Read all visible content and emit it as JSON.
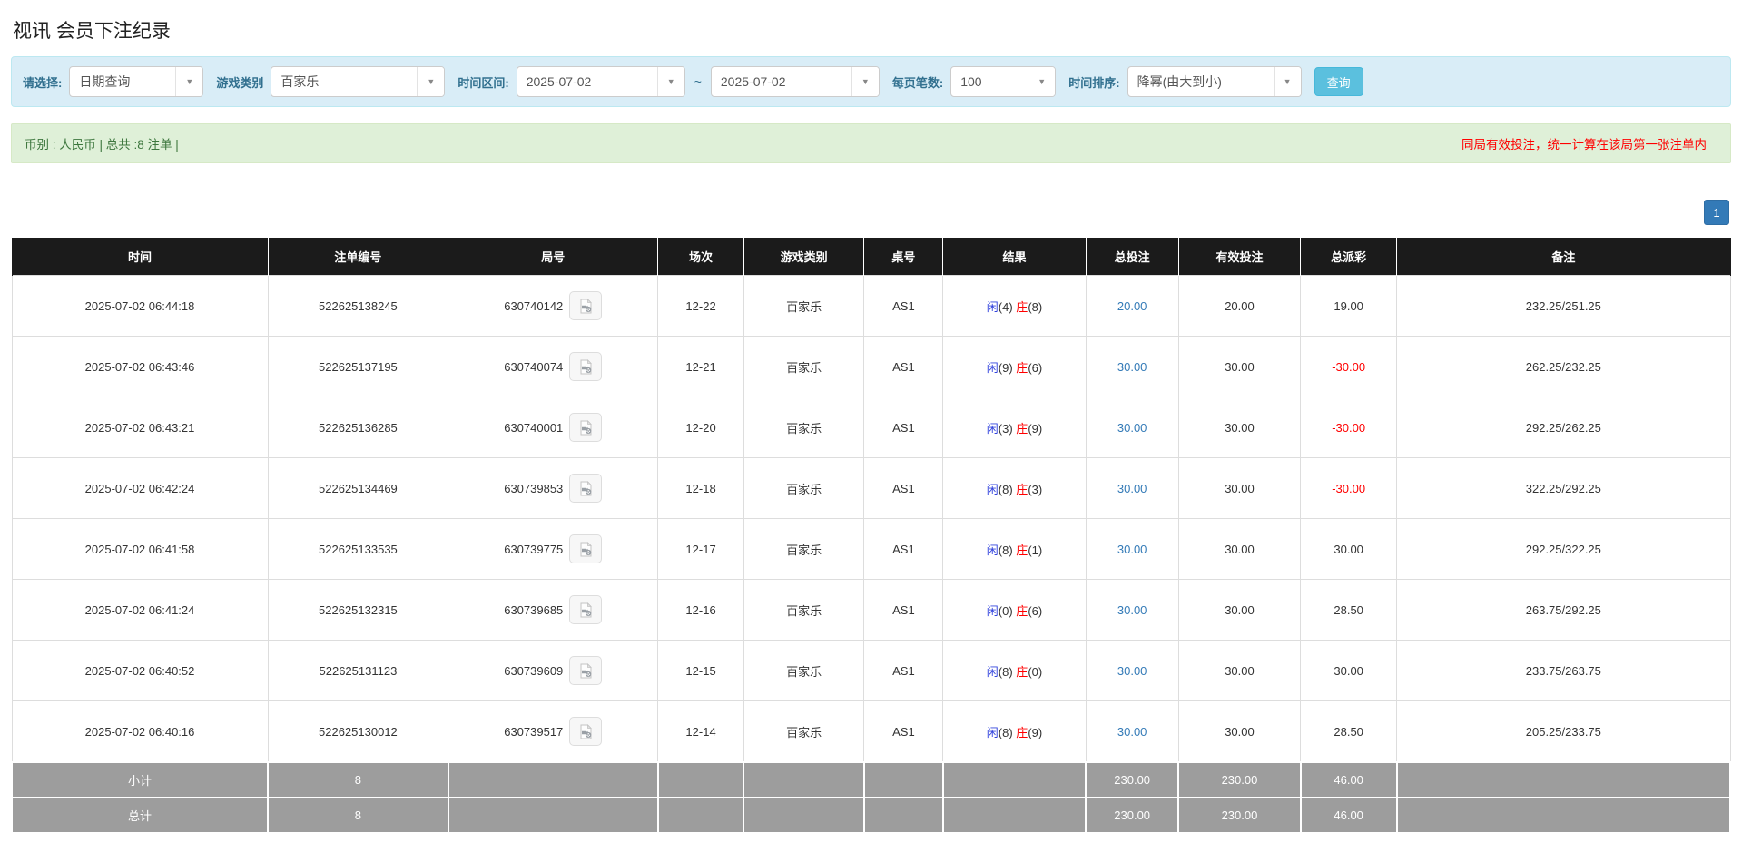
{
  "page": {
    "title": "视讯 会员下注纪录"
  },
  "filters": {
    "query_type_label": "请选择:",
    "query_type_value": "日期查询",
    "game_label": "游戏类别",
    "game_value": "百家乐",
    "range_label": "时间区间:",
    "date_from": "2025-07-02",
    "range_separator": "~",
    "date_to": "2025-07-02",
    "per_page_label": "每页笔数:",
    "per_page_value": "100",
    "sort_label": "时间排序:",
    "sort_value": "降幂(由大到小)",
    "search_button_label": "查询"
  },
  "summary_bar": {
    "left_text": "币别 : 人民币 | 总共 :8 注单 |",
    "right_text": "同局有效投注，统一计算在该局第一张注单内"
  },
  "pagination": {
    "current_page": "1"
  },
  "icons": {
    "dropdown_arrow": "▼",
    "video_replay": "video-replay-icon"
  },
  "colors": {
    "panel_bg": "#d9edf7",
    "panel_border": "#bce8f1",
    "label_text": "#31708f",
    "search_button_bg": "#5bc0de",
    "alert_bg": "#dff0d8",
    "alert_text": "#3c763d",
    "alert_warning_text": "#ff0000",
    "header_bg": "#1b1b1b",
    "link_blue": "#337ab7",
    "player_blue": "#3344dd",
    "banker_red": "#ff0000",
    "negative_red": "#ff0000",
    "summary_row_bg": "#9d9d9d",
    "pagination_bg": "#337ab7"
  },
  "table": {
    "headers": [
      "时间",
      "注单编号",
      "局号",
      "场次",
      "游戏类别",
      "桌号",
      "结果",
      "总投注",
      "有效投注",
      "总派彩",
      "备注"
    ],
    "result_labels": {
      "player": "闲",
      "banker": "庄"
    },
    "rows": [
      {
        "time": "2025-07-02 06:44:18",
        "bet_id": "522625138245",
        "round": "630740142",
        "session": "12-22",
        "game": "百家乐",
        "table_no": "AS1",
        "player_pts": "(4)",
        "banker_pts": "(8)",
        "total_bet": "20.00",
        "valid_bet": "20.00",
        "payout": "19.00",
        "remark": "232.25/251.25"
      },
      {
        "time": "2025-07-02 06:43:46",
        "bet_id": "522625137195",
        "round": "630740074",
        "session": "12-21",
        "game": "百家乐",
        "table_no": "AS1",
        "player_pts": "(9)",
        "banker_pts": "(6)",
        "total_bet": "30.00",
        "valid_bet": "30.00",
        "payout": "-30.00",
        "remark": "262.25/232.25"
      },
      {
        "time": "2025-07-02 06:43:21",
        "bet_id": "522625136285",
        "round": "630740001",
        "session": "12-20",
        "game": "百家乐",
        "table_no": "AS1",
        "player_pts": "(3)",
        "banker_pts": "(9)",
        "total_bet": "30.00",
        "valid_bet": "30.00",
        "payout": "-30.00",
        "remark": "292.25/262.25"
      },
      {
        "time": "2025-07-02 06:42:24",
        "bet_id": "522625134469",
        "round": "630739853",
        "session": "12-18",
        "game": "百家乐",
        "table_no": "AS1",
        "player_pts": "(8)",
        "banker_pts": "(3)",
        "total_bet": "30.00",
        "valid_bet": "30.00",
        "payout": "-30.00",
        "remark": "322.25/292.25"
      },
      {
        "time": "2025-07-02 06:41:58",
        "bet_id": "522625133535",
        "round": "630739775",
        "session": "12-17",
        "game": "百家乐",
        "table_no": "AS1",
        "player_pts": "(8)",
        "banker_pts": "(1)",
        "total_bet": "30.00",
        "valid_bet": "30.00",
        "payout": "30.00",
        "remark": "292.25/322.25"
      },
      {
        "time": "2025-07-02 06:41:24",
        "bet_id": "522625132315",
        "round": "630739685",
        "session": "12-16",
        "game": "百家乐",
        "table_no": "AS1",
        "player_pts": "(0)",
        "banker_pts": "(6)",
        "total_bet": "30.00",
        "valid_bet": "30.00",
        "payout": "28.50",
        "remark": "263.75/292.25"
      },
      {
        "time": "2025-07-02 06:40:52",
        "bet_id": "522625131123",
        "round": "630739609",
        "session": "12-15",
        "game": "百家乐",
        "table_no": "AS1",
        "player_pts": "(8)",
        "banker_pts": "(0)",
        "total_bet": "30.00",
        "valid_bet": "30.00",
        "payout": "30.00",
        "remark": "233.75/263.75"
      },
      {
        "time": "2025-07-02 06:40:16",
        "bet_id": "522625130012",
        "round": "630739517",
        "session": "12-14",
        "game": "百家乐",
        "table_no": "AS1",
        "player_pts": "(8)",
        "banker_pts": "(9)",
        "total_bet": "30.00",
        "valid_bet": "30.00",
        "payout": "28.50",
        "remark": "205.25/233.75"
      }
    ],
    "subtotal": {
      "label": "小计",
      "count": "8",
      "total_bet": "230.00",
      "valid_bet": "230.00",
      "payout": "46.00"
    },
    "grand_total": {
      "label": "总计",
      "count": "8",
      "total_bet": "230.00",
      "valid_bet": "230.00",
      "payout": "46.00"
    }
  }
}
